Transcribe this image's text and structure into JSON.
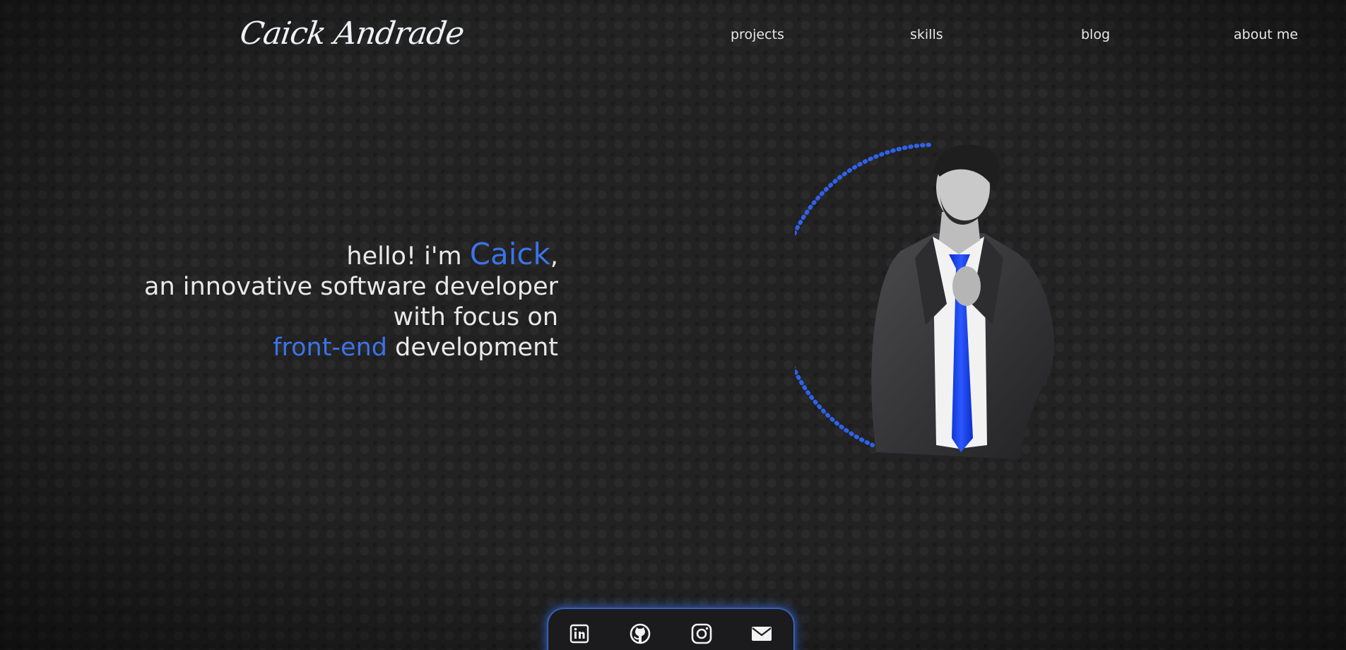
{
  "header": {
    "logo_text": "Caick Andrade",
    "nav": {
      "projects": "projects",
      "skills": "skills",
      "blog": "blog",
      "about": "about me"
    }
  },
  "hero": {
    "greeting": "hello! i'm ",
    "name": "Caick",
    "comma": ",",
    "line2": "an innovative software developer",
    "line3": "with focus on",
    "focus_accent": "front-end",
    "focus_rest": " development"
  },
  "social": {
    "icons": [
      "linkedin-icon",
      "github-icon",
      "instagram-icon",
      "email-icon"
    ]
  },
  "colors": {
    "accent": "#3b73ea",
    "background": "#222222",
    "text": "#e9e9e9"
  }
}
